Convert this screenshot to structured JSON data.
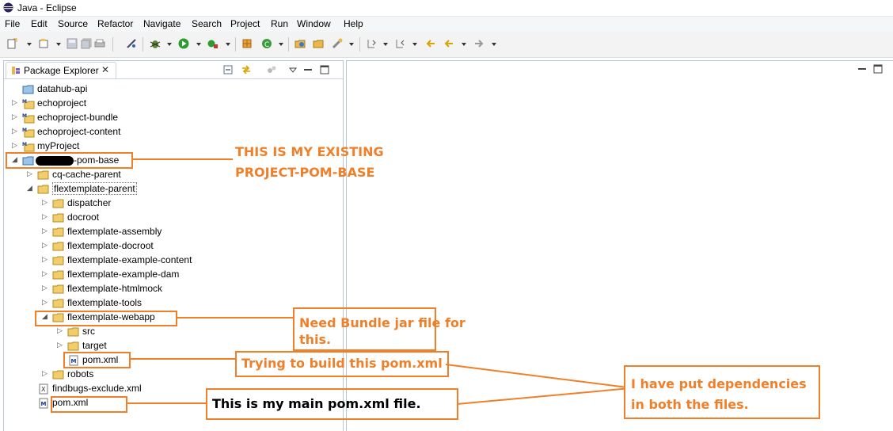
{
  "window": {
    "title": "Java - Eclipse"
  },
  "menu": [
    "File",
    "Edit",
    "Source",
    "Refactor",
    "Navigate",
    "Search",
    "Project",
    "Run",
    "Window",
    "Help"
  ],
  "package_explorer": {
    "tab_label": "Package Explorer",
    "close_glyph": "✕",
    "items": [
      {
        "label": "datahub-api",
        "icon": "project-folder-icon",
        "toggle": ""
      },
      {
        "label": "echoproject",
        "icon": "maven-project-icon",
        "toggle": "▷"
      },
      {
        "label": "echoproject-bundle",
        "icon": "maven-project-icon",
        "toggle": "▷"
      },
      {
        "label": "echoproject-content",
        "icon": "maven-project-icon",
        "toggle": "▷"
      },
      {
        "label": "myProject",
        "icon": "maven-project-icon",
        "toggle": "▷"
      },
      {
        "label": "-pom-base",
        "icon": "project-folder-icon",
        "toggle": "◢"
      },
      {
        "label": "cq-cache-parent",
        "icon": "folder-icon",
        "toggle": "▷"
      },
      {
        "label": "flextemplate-parent",
        "icon": "folder-icon",
        "toggle": "◢"
      },
      {
        "label": "dispatcher",
        "icon": "folder-icon",
        "toggle": "▷"
      },
      {
        "label": "docroot",
        "icon": "folder-icon",
        "toggle": "▷"
      },
      {
        "label": "flextemplate-assembly",
        "icon": "folder-icon",
        "toggle": "▷"
      },
      {
        "label": "flextemplate-docroot",
        "icon": "folder-icon",
        "toggle": "▷"
      },
      {
        "label": "flextemplate-example-content",
        "icon": "folder-icon",
        "toggle": "▷"
      },
      {
        "label": "flextemplate-example-dam",
        "icon": "folder-icon",
        "toggle": "▷"
      },
      {
        "label": "flextemplate-htmlmock",
        "icon": "folder-icon",
        "toggle": "▷"
      },
      {
        "label": "flextemplate-tools",
        "icon": "folder-icon",
        "toggle": "▷"
      },
      {
        "label": "flextemplate-webapp",
        "icon": "folder-icon",
        "toggle": "◢"
      },
      {
        "label": "src",
        "icon": "folder-icon",
        "toggle": "▷"
      },
      {
        "label": "target",
        "icon": "folder-icon",
        "toggle": "▷"
      },
      {
        "label": "pom.xml",
        "icon": "maven-pom-icon",
        "toggle": ""
      },
      {
        "label": "robots",
        "icon": "folder-icon",
        "toggle": "▷"
      },
      {
        "label": "findbugs-exclude.xml",
        "icon": "xml-file-icon",
        "toggle": ""
      },
      {
        "label": "pom.xml",
        "icon": "maven-pom-icon",
        "toggle": ""
      }
    ]
  },
  "annotations": {
    "existing_project": [
      "THIS IS MY EXISTING",
      "PROJECT-POM-BASE"
    ],
    "need_bundle": [
      "Need Bundle jar file for",
      "this."
    ],
    "trying_build": "Trying to build this pom.xml",
    "main_pom": "This is my main pom.xml file.",
    "dependencies": [
      "I have put dependencies",
      "in both the files."
    ]
  },
  "colors": {
    "annotation": "#f07f2a",
    "folder": "#e8b84a",
    "selection_border": "#7a7a7a"
  }
}
